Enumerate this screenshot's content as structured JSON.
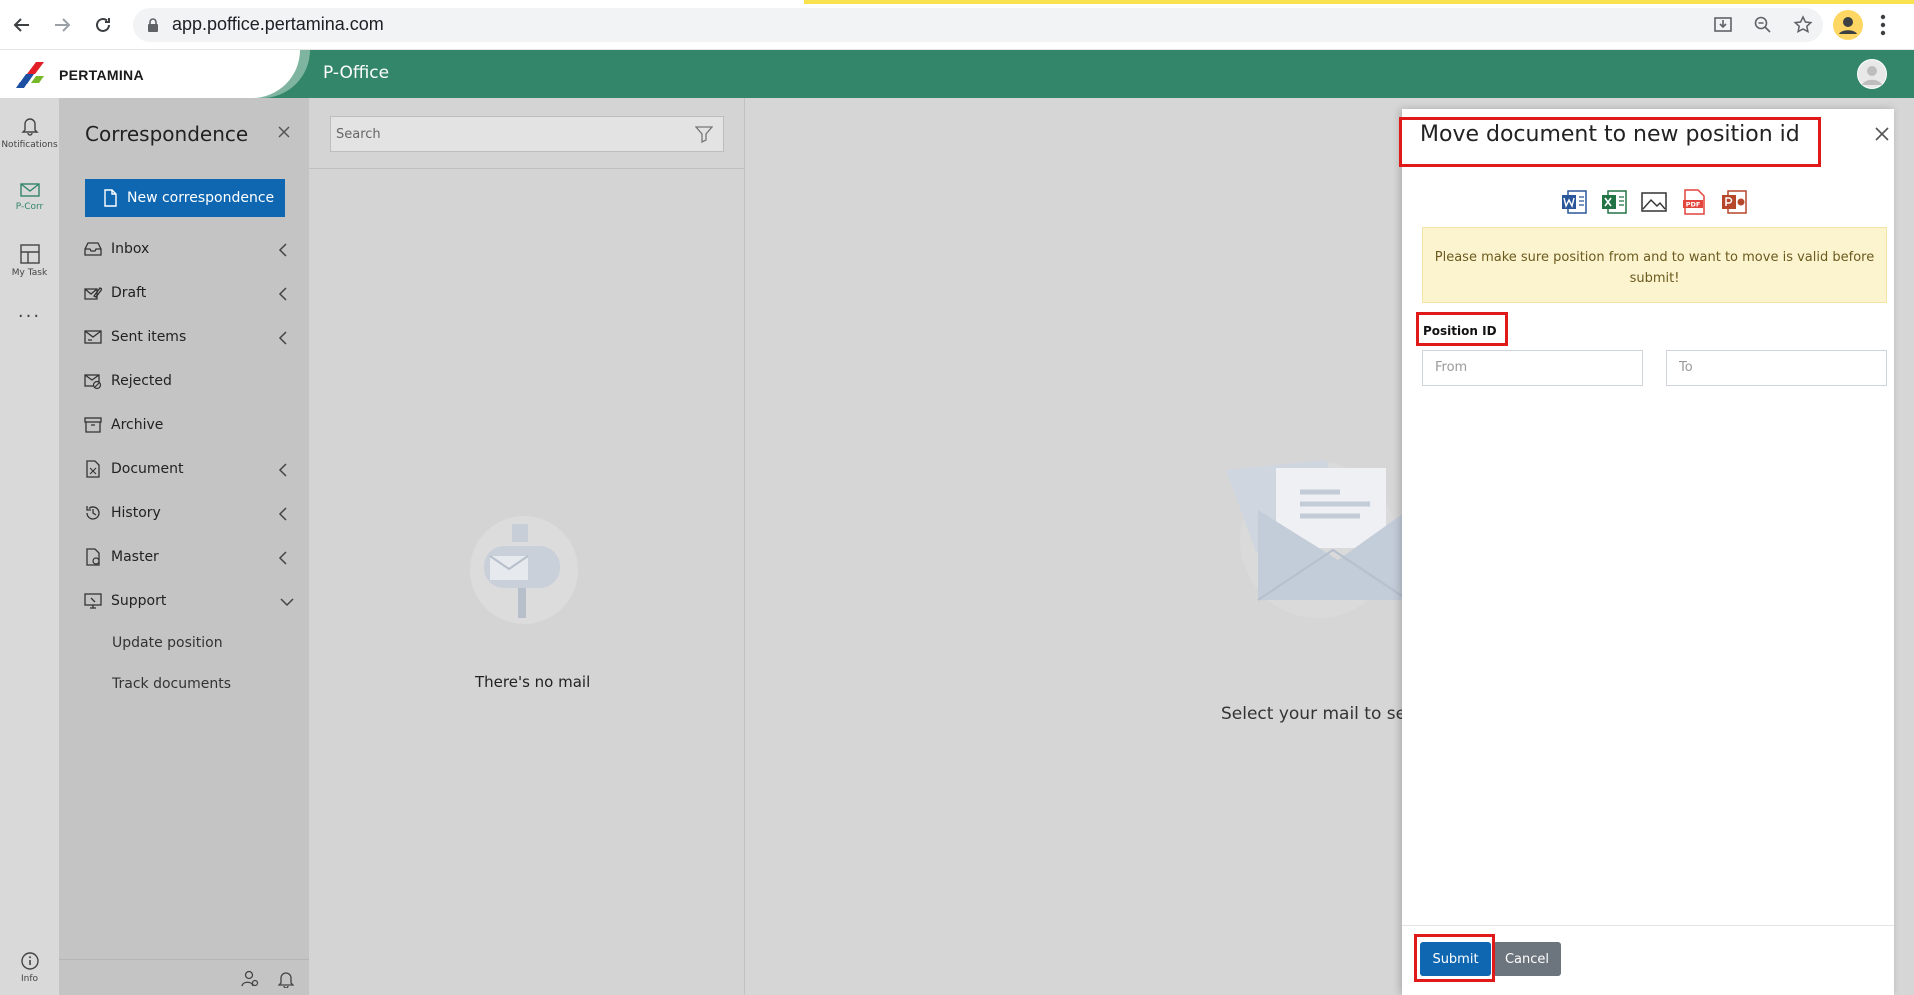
{
  "browser": {
    "url": "app.poffice.pertamina.com",
    "nav": {
      "back_icon": "arrow-left-icon",
      "forward_icon": "arrow-right-icon",
      "reload_icon": "reload-icon"
    }
  },
  "app": {
    "logo_text": "PERTAMINA",
    "title": "P-Office",
    "brand_color": "#33866a",
    "primary_color": "#0f67b1"
  },
  "rail": {
    "items": [
      {
        "label": "Notifications",
        "icon": "bell-icon"
      },
      {
        "label": "P-Corr",
        "icon": "mail-icon"
      },
      {
        "label": "My Task",
        "icon": "task-board-icon"
      }
    ],
    "more": "···",
    "info": "Info"
  },
  "correspondence": {
    "title": "Correspondence",
    "new_button": "New correspondence",
    "menu": [
      {
        "label": "Inbox",
        "icon": "inbox-icon"
      },
      {
        "label": "Draft",
        "icon": "draft-icon"
      },
      {
        "label": "Sent items",
        "icon": "sent-icon"
      },
      {
        "label": "Rejected",
        "icon": "rejected-icon"
      },
      {
        "label": "Archive",
        "icon": "archive-icon"
      },
      {
        "label": "Document",
        "icon": "document-icon"
      },
      {
        "label": "History",
        "icon": "history-icon"
      },
      {
        "label": "Master",
        "icon": "master-icon"
      },
      {
        "label": "Support",
        "icon": "support-icon"
      }
    ],
    "support_sub": [
      "Update position",
      "Track documents"
    ]
  },
  "maillist": {
    "search_placeholder": "Search",
    "empty_text": "There's no mail"
  },
  "reading": {
    "empty_text": "Select your mail to see d"
  },
  "modal": {
    "title": "Move document to new position id",
    "file_icons": [
      "word-icon",
      "excel-icon",
      "image-icon",
      "pdf-icon",
      "powerpoint-icon"
    ],
    "warning": "Please make sure position from and to want to move is valid before submit!",
    "field_label": "Position ID",
    "from_placeholder": "From",
    "to_placeholder": "To",
    "submit_label": "Submit",
    "cancel_label": "Cancel",
    "highlight_color": "#e01919"
  }
}
